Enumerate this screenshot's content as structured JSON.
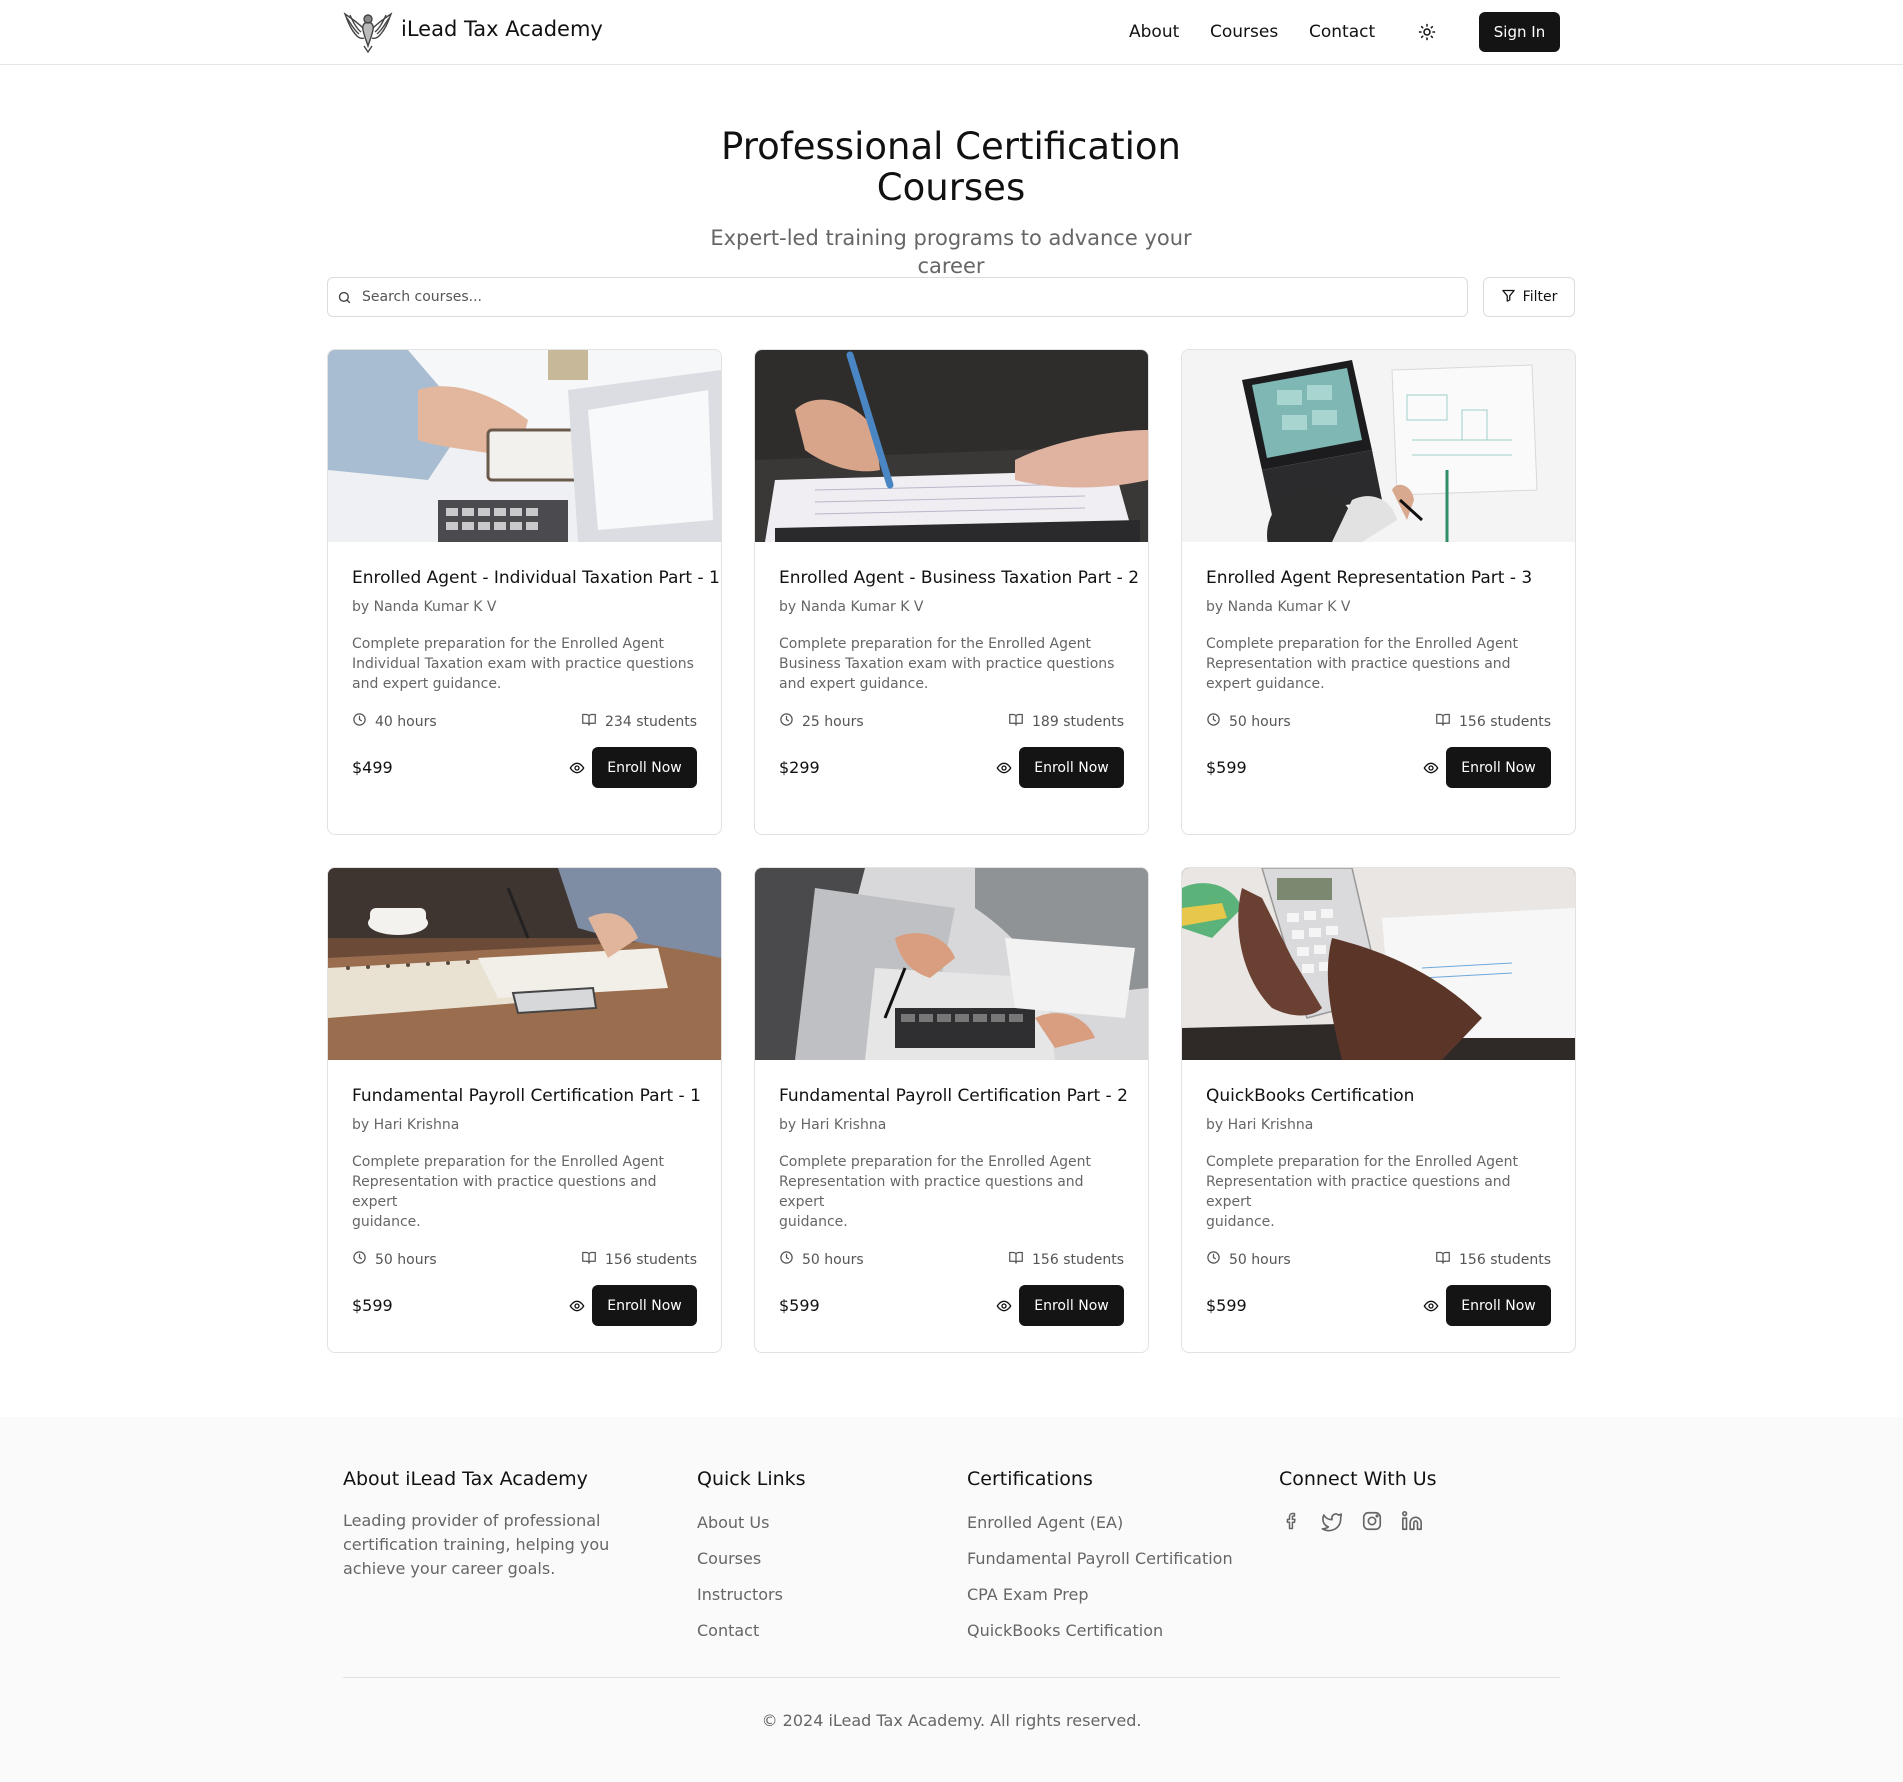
{
  "header": {
    "brand": "iLead Tax Academy",
    "nav": [
      "About",
      "Courses",
      "Contact"
    ],
    "sign_in": "Sign In"
  },
  "hero": {
    "title": "Professional Certification Courses",
    "subtitle": "Expert-led training programs to advance your career"
  },
  "search": {
    "placeholder": "Search courses...",
    "filter_label": "Filter"
  },
  "courses": [
    {
      "title": "Enrolled Agent - Individual Taxation Part - 1",
      "author": "by Nanda Kumar K V",
      "description": "Complete preparation for the Enrolled Agent Individual Taxation exam with practice questions and expert guidance.",
      "hours": "40 hours",
      "students": "234 students",
      "price": "$499",
      "enroll_label": "Enroll Now"
    },
    {
      "title": "Enrolled Agent - Business Taxation Part - 2",
      "author": "by Nanda Kumar K V",
      "description": "Complete preparation for the Enrolled Agent Business Taxation exam with practice questions and expert guidance.",
      "hours": "25 hours",
      "students": "189 students",
      "price": "$299",
      "enroll_label": "Enroll Now"
    },
    {
      "title": "Enrolled Agent Representation Part - 3",
      "author": "by Nanda Kumar K V",
      "description": "Complete preparation for the Enrolled Agent Representation with practice questions and expert guidance.",
      "hours": "50 hours",
      "students": "156 students",
      "price": "$599",
      "enroll_label": "Enroll Now"
    },
    {
      "title": "Fundamental Payroll Certification Part - 1",
      "author": "by Hari Krishna",
      "description": "Complete preparation for the Enrolled Agent Representation with practice questions and expert\nguidance.",
      "hours": "50 hours",
      "students": "156 students",
      "price": "$599",
      "enroll_label": "Enroll Now"
    },
    {
      "title": "Fundamental Payroll Certification Part - 2",
      "author": "by Hari Krishna",
      "description": "Complete preparation for the Enrolled Agent Representation with practice questions and expert\nguidance.",
      "hours": "50 hours",
      "students": "156 students",
      "price": "$599",
      "enroll_label": "Enroll Now"
    },
    {
      "title": "QuickBooks Certification",
      "author": "by Hari Krishna",
      "description": "Complete preparation for the Enrolled Agent Representation with practice questions and expert\nguidance.",
      "hours": "50 hours",
      "students": "156 students",
      "price": "$599",
      "enroll_label": "Enroll Now"
    }
  ],
  "footer": {
    "about_heading": "About iLead Tax Academy",
    "about_text": "Leading provider of professional certification training, helping you achieve your career goals.",
    "quick_links_heading": "Quick Links",
    "quick_links": [
      "About Us",
      "Courses",
      "Instructors",
      "Contact"
    ],
    "certifications_heading": "Certifications",
    "certifications": [
      "Enrolled Agent (EA)",
      "Fundamental Payroll Certification",
      "CPA Exam Prep",
      "QuickBooks Certification"
    ],
    "connect_heading": "Connect With Us",
    "social_icons": [
      "facebook-icon",
      "twitter-icon",
      "instagram-icon",
      "linkedin-icon"
    ],
    "copyright": "© 2024 iLead Tax Academy. All rights reserved."
  },
  "colors": {
    "primary_button": "#141414",
    "muted_text": "#666666",
    "border": "#e2e2e2",
    "footer_bg": "#fafafa"
  }
}
